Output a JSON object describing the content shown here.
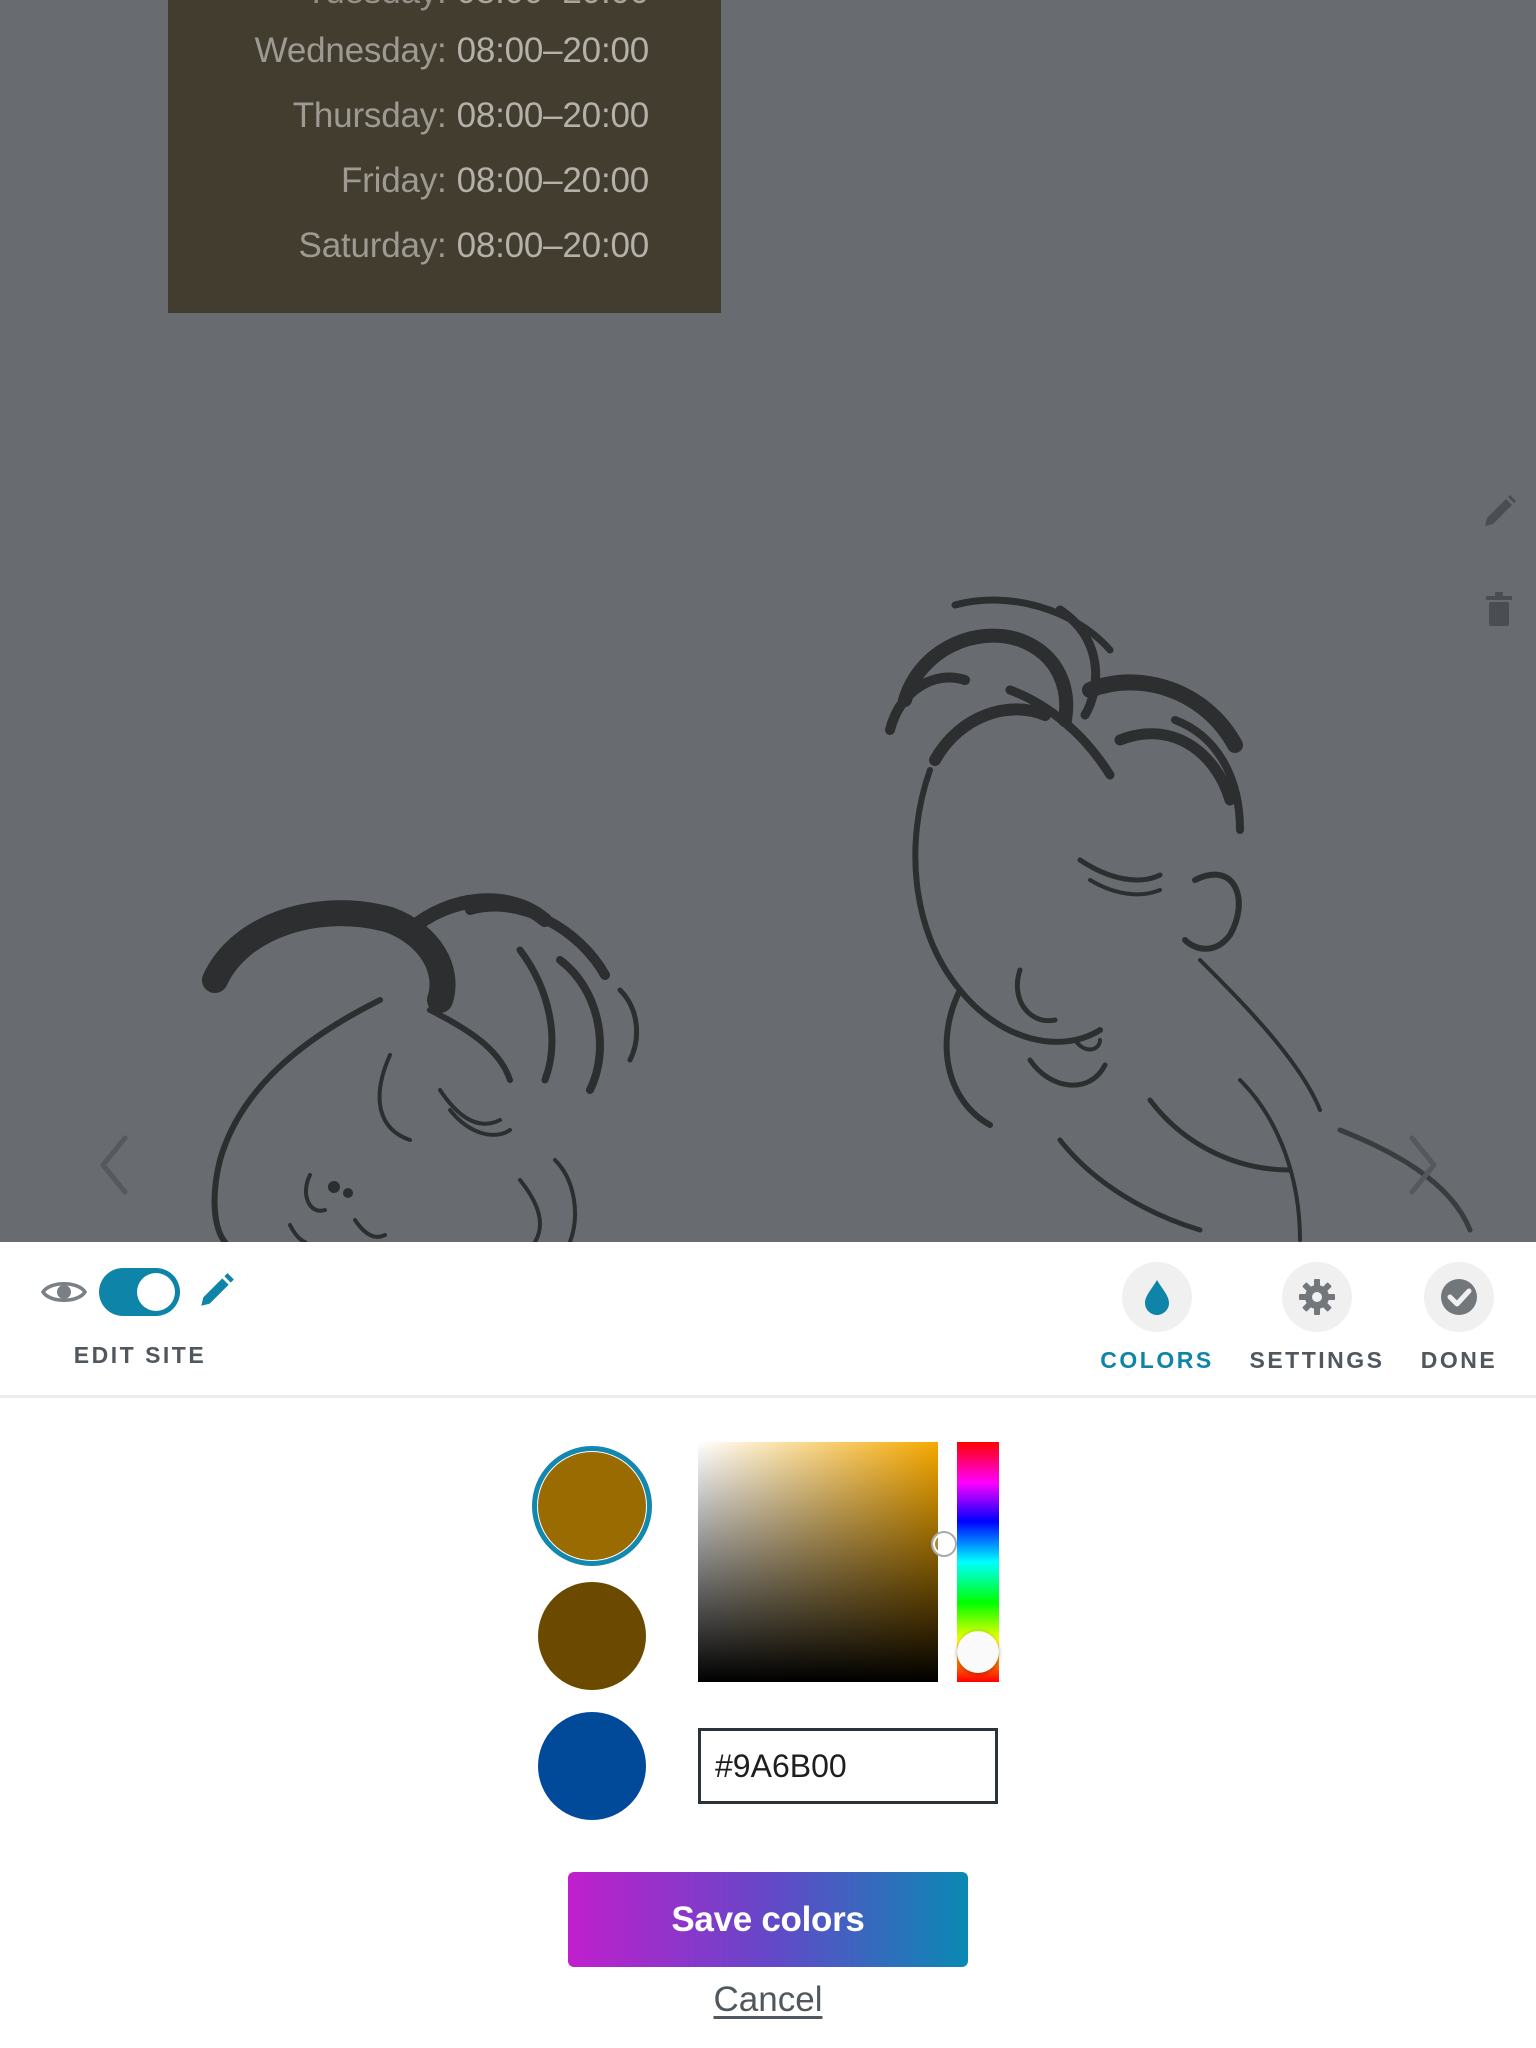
{
  "preview": {
    "hours": [
      {
        "day": "Wednesday:",
        "time": "08:00–20:00"
      },
      {
        "day": "Thursday:",
        "time": "08:00–20:00"
      },
      {
        "day": "Friday:",
        "time": "08:00–20:00"
      },
      {
        "day": "Saturday:",
        "time": "08:00–20:00"
      }
    ],
    "icons": {
      "edit": "pencil-icon",
      "delete": "trash-icon",
      "prev": "chevron-left-icon",
      "next": "chevron-right-icon"
    }
  },
  "toolbar": {
    "edit_site_label": "EDIT SITE",
    "toggle_on": true,
    "tabs": [
      {
        "label": "COLORS",
        "icon": "drop-icon",
        "active": true
      },
      {
        "label": "SETTINGS",
        "icon": "gear-icon",
        "active": false
      },
      {
        "label": "DONE",
        "icon": "check-icon",
        "active": false
      }
    ],
    "accent": "#0d84a8"
  },
  "colors": {
    "swatches": [
      "#9A6B00",
      "#6B4A00",
      "#004A99"
    ],
    "selected_index": 0,
    "hex_value": "#9A6B00",
    "picker_hue": "#f5a800",
    "save_label": "Save colors",
    "cancel_label": "Cancel"
  }
}
